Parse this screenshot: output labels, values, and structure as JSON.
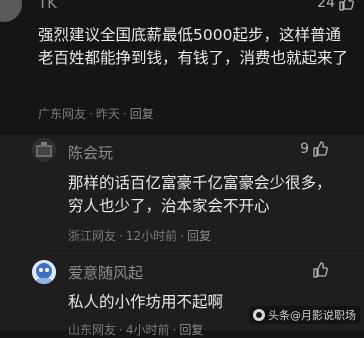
{
  "comment": {
    "username": "TK",
    "likes": "24",
    "text": "强烈建议全国底薪最低5000起步，这样普通老百姓都能挣到钱，有钱了，消费也就起来了",
    "location": "广东网友",
    "time": "昨天",
    "reply_label": "回复"
  },
  "replies": [
    {
      "username": "陈会玩",
      "likes": "9",
      "text": "那样的话百亿富豪千亿富豪会少很多，穷人也少了，治本家会不开心",
      "location": "浙江网友",
      "time": "12小时前",
      "reply_label": "回复"
    },
    {
      "username": "爱意随风起",
      "likes": "",
      "text": "私人的小作坊用不起啊",
      "location": "山东网友",
      "time": "4小时前",
      "reply_label": "回复"
    }
  ],
  "watermark": "头条@月影说职场",
  "colors": {
    "background": "#151515",
    "reply_background": "#1e1e1e",
    "text": "#e9e9e9",
    "muted": "#7a7a7a"
  }
}
